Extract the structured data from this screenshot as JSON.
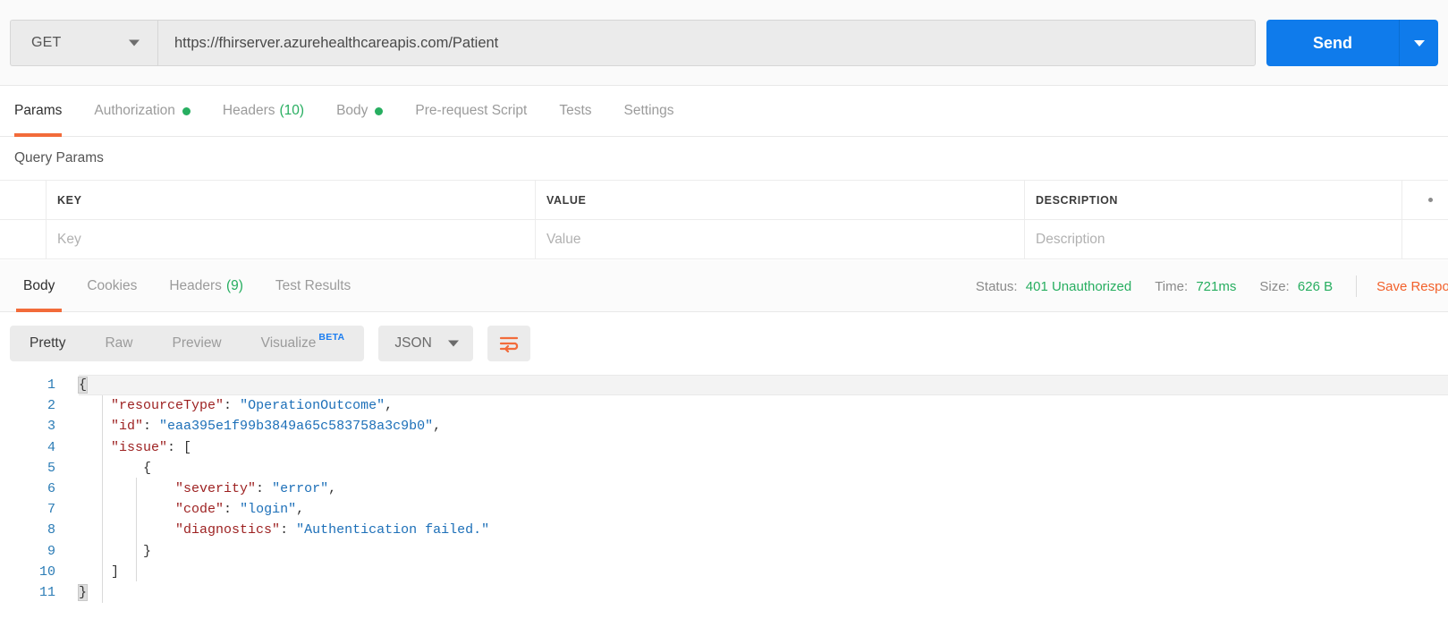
{
  "request": {
    "method": "GET",
    "url": "https://fhirserver.azurehealthcareapis.com/Patient",
    "send_label": "Send",
    "method_caret": "chevron-down-icon",
    "send_caret": "chevron-down-icon"
  },
  "request_tabs": [
    {
      "label": "Params",
      "active": true,
      "dot": false,
      "count": ""
    },
    {
      "label": "Authorization",
      "active": false,
      "dot": true,
      "count": ""
    },
    {
      "label": "Headers",
      "active": false,
      "dot": false,
      "count": "(10)"
    },
    {
      "label": "Body",
      "active": false,
      "dot": true,
      "count": ""
    },
    {
      "label": "Pre-request Script",
      "active": false,
      "dot": false,
      "count": ""
    },
    {
      "label": "Tests",
      "active": false,
      "dot": false,
      "count": ""
    },
    {
      "label": "Settings",
      "active": false,
      "dot": false,
      "count": ""
    }
  ],
  "query_params": {
    "section_title": "Query Params",
    "headers": {
      "key": "KEY",
      "value": "VALUE",
      "description": "DESCRIPTION"
    },
    "rows": [
      {
        "key": "Key",
        "value": "Value",
        "description": "Description"
      }
    ],
    "bulk_edit_icon": "dots-icon"
  },
  "response_tabs": [
    {
      "label": "Body",
      "active": true,
      "count": ""
    },
    {
      "label": "Cookies",
      "active": false,
      "count": ""
    },
    {
      "label": "Headers",
      "active": false,
      "count": "(9)"
    },
    {
      "label": "Test Results",
      "active": false,
      "count": ""
    }
  ],
  "response_status": {
    "status_label": "Status:",
    "status_value": "401 Unauthorized",
    "time_label": "Time:",
    "time_value": "721ms",
    "size_label": "Size:",
    "size_value": "626 B",
    "save_label": "Save Response"
  },
  "view_toolbar": {
    "modes": [
      {
        "label": "Pretty",
        "active": true,
        "badge": ""
      },
      {
        "label": "Raw",
        "active": false,
        "badge": ""
      },
      {
        "label": "Preview",
        "active": false,
        "badge": ""
      },
      {
        "label": "Visualize",
        "active": false,
        "badge": "BETA"
      }
    ],
    "format": "JSON",
    "format_caret": "chevron-down-icon",
    "wrap_icon": "wrap-lines-icon"
  },
  "response_body": {
    "language": "json",
    "lines": [
      {
        "n": "1",
        "segments": [
          {
            "t": "{",
            "c": "p brace-hl"
          }
        ]
      },
      {
        "n": "2",
        "segments": [
          {
            "t": "    ",
            "c": "p"
          },
          {
            "t": "\"resourceType\"",
            "c": "k"
          },
          {
            "t": ": ",
            "c": "p"
          },
          {
            "t": "\"OperationOutcome\"",
            "c": "s"
          },
          {
            "t": ",",
            "c": "p"
          }
        ]
      },
      {
        "n": "3",
        "segments": [
          {
            "t": "    ",
            "c": "p"
          },
          {
            "t": "\"id\"",
            "c": "k"
          },
          {
            "t": ": ",
            "c": "p"
          },
          {
            "t": "\"eaa395e1f99b3849a65c583758a3c9b0\"",
            "c": "s"
          },
          {
            "t": ",",
            "c": "p"
          }
        ]
      },
      {
        "n": "4",
        "segments": [
          {
            "t": "    ",
            "c": "p"
          },
          {
            "t": "\"issue\"",
            "c": "k"
          },
          {
            "t": ": ",
            "c": "p"
          },
          {
            "t": "[",
            "c": "p"
          }
        ]
      },
      {
        "n": "5",
        "segments": [
          {
            "t": "        {",
            "c": "p"
          }
        ]
      },
      {
        "n": "6",
        "segments": [
          {
            "t": "            ",
            "c": "p"
          },
          {
            "t": "\"severity\"",
            "c": "k"
          },
          {
            "t": ": ",
            "c": "p"
          },
          {
            "t": "\"error\"",
            "c": "s"
          },
          {
            "t": ",",
            "c": "p"
          }
        ]
      },
      {
        "n": "7",
        "segments": [
          {
            "t": "            ",
            "c": "p"
          },
          {
            "t": "\"code\"",
            "c": "k"
          },
          {
            "t": ": ",
            "c": "p"
          },
          {
            "t": "\"login\"",
            "c": "s"
          },
          {
            "t": ",",
            "c": "p"
          }
        ]
      },
      {
        "n": "8",
        "segments": [
          {
            "t": "            ",
            "c": "p"
          },
          {
            "t": "\"diagnostics\"",
            "c": "k"
          },
          {
            "t": ": ",
            "c": "p"
          },
          {
            "t": "\"Authentication failed.\"",
            "c": "s"
          }
        ]
      },
      {
        "n": "9",
        "segments": [
          {
            "t": "        }",
            "c": "p"
          }
        ]
      },
      {
        "n": "10",
        "segments": [
          {
            "t": "    ]",
            "c": "p"
          }
        ]
      },
      {
        "n": "11",
        "segments": [
          {
            "t": "}",
            "c": "p brace-hl"
          }
        ]
      }
    ]
  },
  "colors": {
    "accent_orange": "#f26b3a",
    "send_blue": "#0f7beb",
    "status_green": "#27ae60",
    "beta_blue": "#1d7ef0",
    "json_key": "#9c1f1f",
    "json_string": "#1c6fb8",
    "gutter_blue": "#2a7bb5"
  }
}
